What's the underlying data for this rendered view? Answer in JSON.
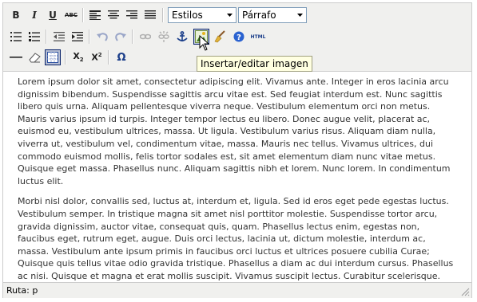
{
  "toolbar": {
    "bold_icon": "B",
    "italic_icon": "I",
    "underline_icon": "U",
    "strike_icon": "ABC",
    "styles_select": "Estilos",
    "format_select": "Párrafo",
    "html_label": "HTML",
    "subscript_label": "X",
    "superscript_label": "X",
    "subscript_index": "2",
    "superscript_index": "2",
    "omega_label": "Ω"
  },
  "tooltip": {
    "text": "Insertar/editar imagen"
  },
  "content": {
    "paragraphs": [
      "Lorem ipsum dolor sit amet, consectetur adipiscing elit. Vivamus ante. Integer in eros lacinia arcu dignissim bibendum. Suspendisse sagittis arcu vitae est. Sed feugiat interdum est. Nunc sagittis libero quis urna. Aliquam pellentesque viverra neque. Vestibulum elementum orci non metus. Mauris varius ipsum id turpis. Integer tempor lectus eu libero. Donec augue velit, placerat ac, euismod eu, vestibulum ultrices, massa. Ut ligula. Vestibulum varius risus. Aliquam diam nulla, viverra ut, vestibulum vel, condimentum vitae, massa. Mauris nec tellus. Vivamus ultrices, dui commodo euismod mollis, felis tortor sodales est, sit amet elementum diam nunc vitae metus. Quisque eget massa. Phasellus nunc. Aliquam sagittis nibh et lorem. Nunc lorem. In condimentum luctus elit.",
      "Morbi nisl dolor, convallis sed, luctus at, interdum et, ligula. Sed id eros eget pede egestas luctus. Vestibulum semper. In tristique magna sit amet nisl porttitor molestie. Suspendisse tortor arcu, gravida dignissim, auctor vitae, consequat quis, quam. Phasellus lectus enim, egestas non, faucibus eget, rutrum eget, augue. Duis orci lectus, lacinia ut, dictum molestie, interdum ac, massa. Vestibulum ante ipsum primis in faucibus orci luctus et ultrices posuere cubilia Curae; Quisque quis tellus vitae odio gravida tristique. Phasellus a diam ac dui interdum cursus. Phasellus ac nisi. Quisque et magna et erat mollis suscipit. Vivamus suscipit lectus. Curabitur scelerisque."
    ]
  },
  "statusbar": {
    "path": "Ruta: p"
  },
  "colors": {
    "toolbar_bg": "#f0f0ee",
    "border": "#cccccc",
    "tooltip_bg": "#ffffe1",
    "active_border": "#0a246a"
  }
}
